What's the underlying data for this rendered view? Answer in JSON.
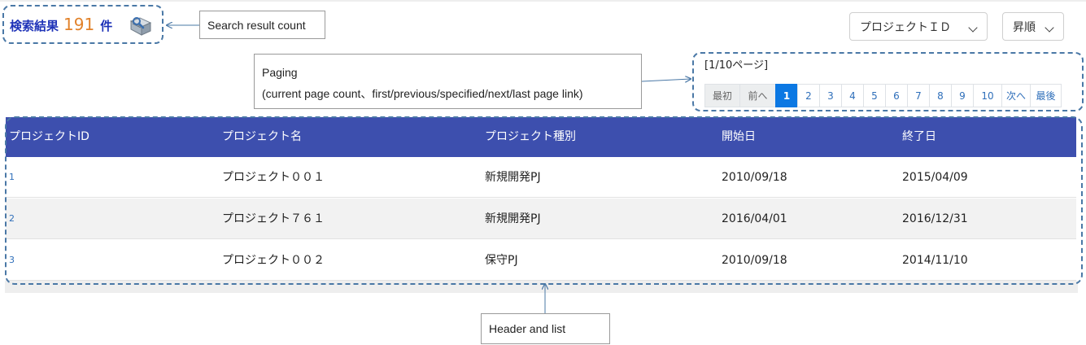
{
  "search_count": {
    "label": "検索結果",
    "count": "191",
    "unit": "件",
    "icon": "book-search-icon"
  },
  "sort": {
    "field": "プロジェクトＩＤ",
    "order": "昇順"
  },
  "paging": {
    "info": "[1/10ページ]",
    "buttons": [
      "最初",
      "前へ",
      "1",
      "2",
      "3",
      "4",
      "5",
      "6",
      "7",
      "8",
      "9",
      "10",
      "次へ",
      "最後"
    ],
    "active": "1"
  },
  "table": {
    "headers": [
      "プロジェクトID",
      "プロジェクト名",
      "プロジェクト種別",
      "開始日",
      "終了日"
    ],
    "rows": [
      [
        "1",
        "プロジェクト００１",
        "新規開発PJ",
        "2010/09/18",
        "2015/04/09"
      ],
      [
        "2",
        "プロジェクト７６１",
        "新規開発PJ",
        "2016/04/01",
        "2016/12/31"
      ],
      [
        "3",
        "プロジェクト００２",
        "保守PJ",
        "2010/09/18",
        "2014/11/10"
      ]
    ]
  },
  "annotations": {
    "count": "Search result count",
    "paging_title": "Paging",
    "paging_desc": "(current page count、first/previous/specified/next/last page link)",
    "header": "Header and list"
  },
  "colors": {
    "header_bg": "#3d4fae",
    "active_page": "#0b78e3",
    "callout_border": "#4a78a6",
    "count_number": "#e2822a"
  }
}
